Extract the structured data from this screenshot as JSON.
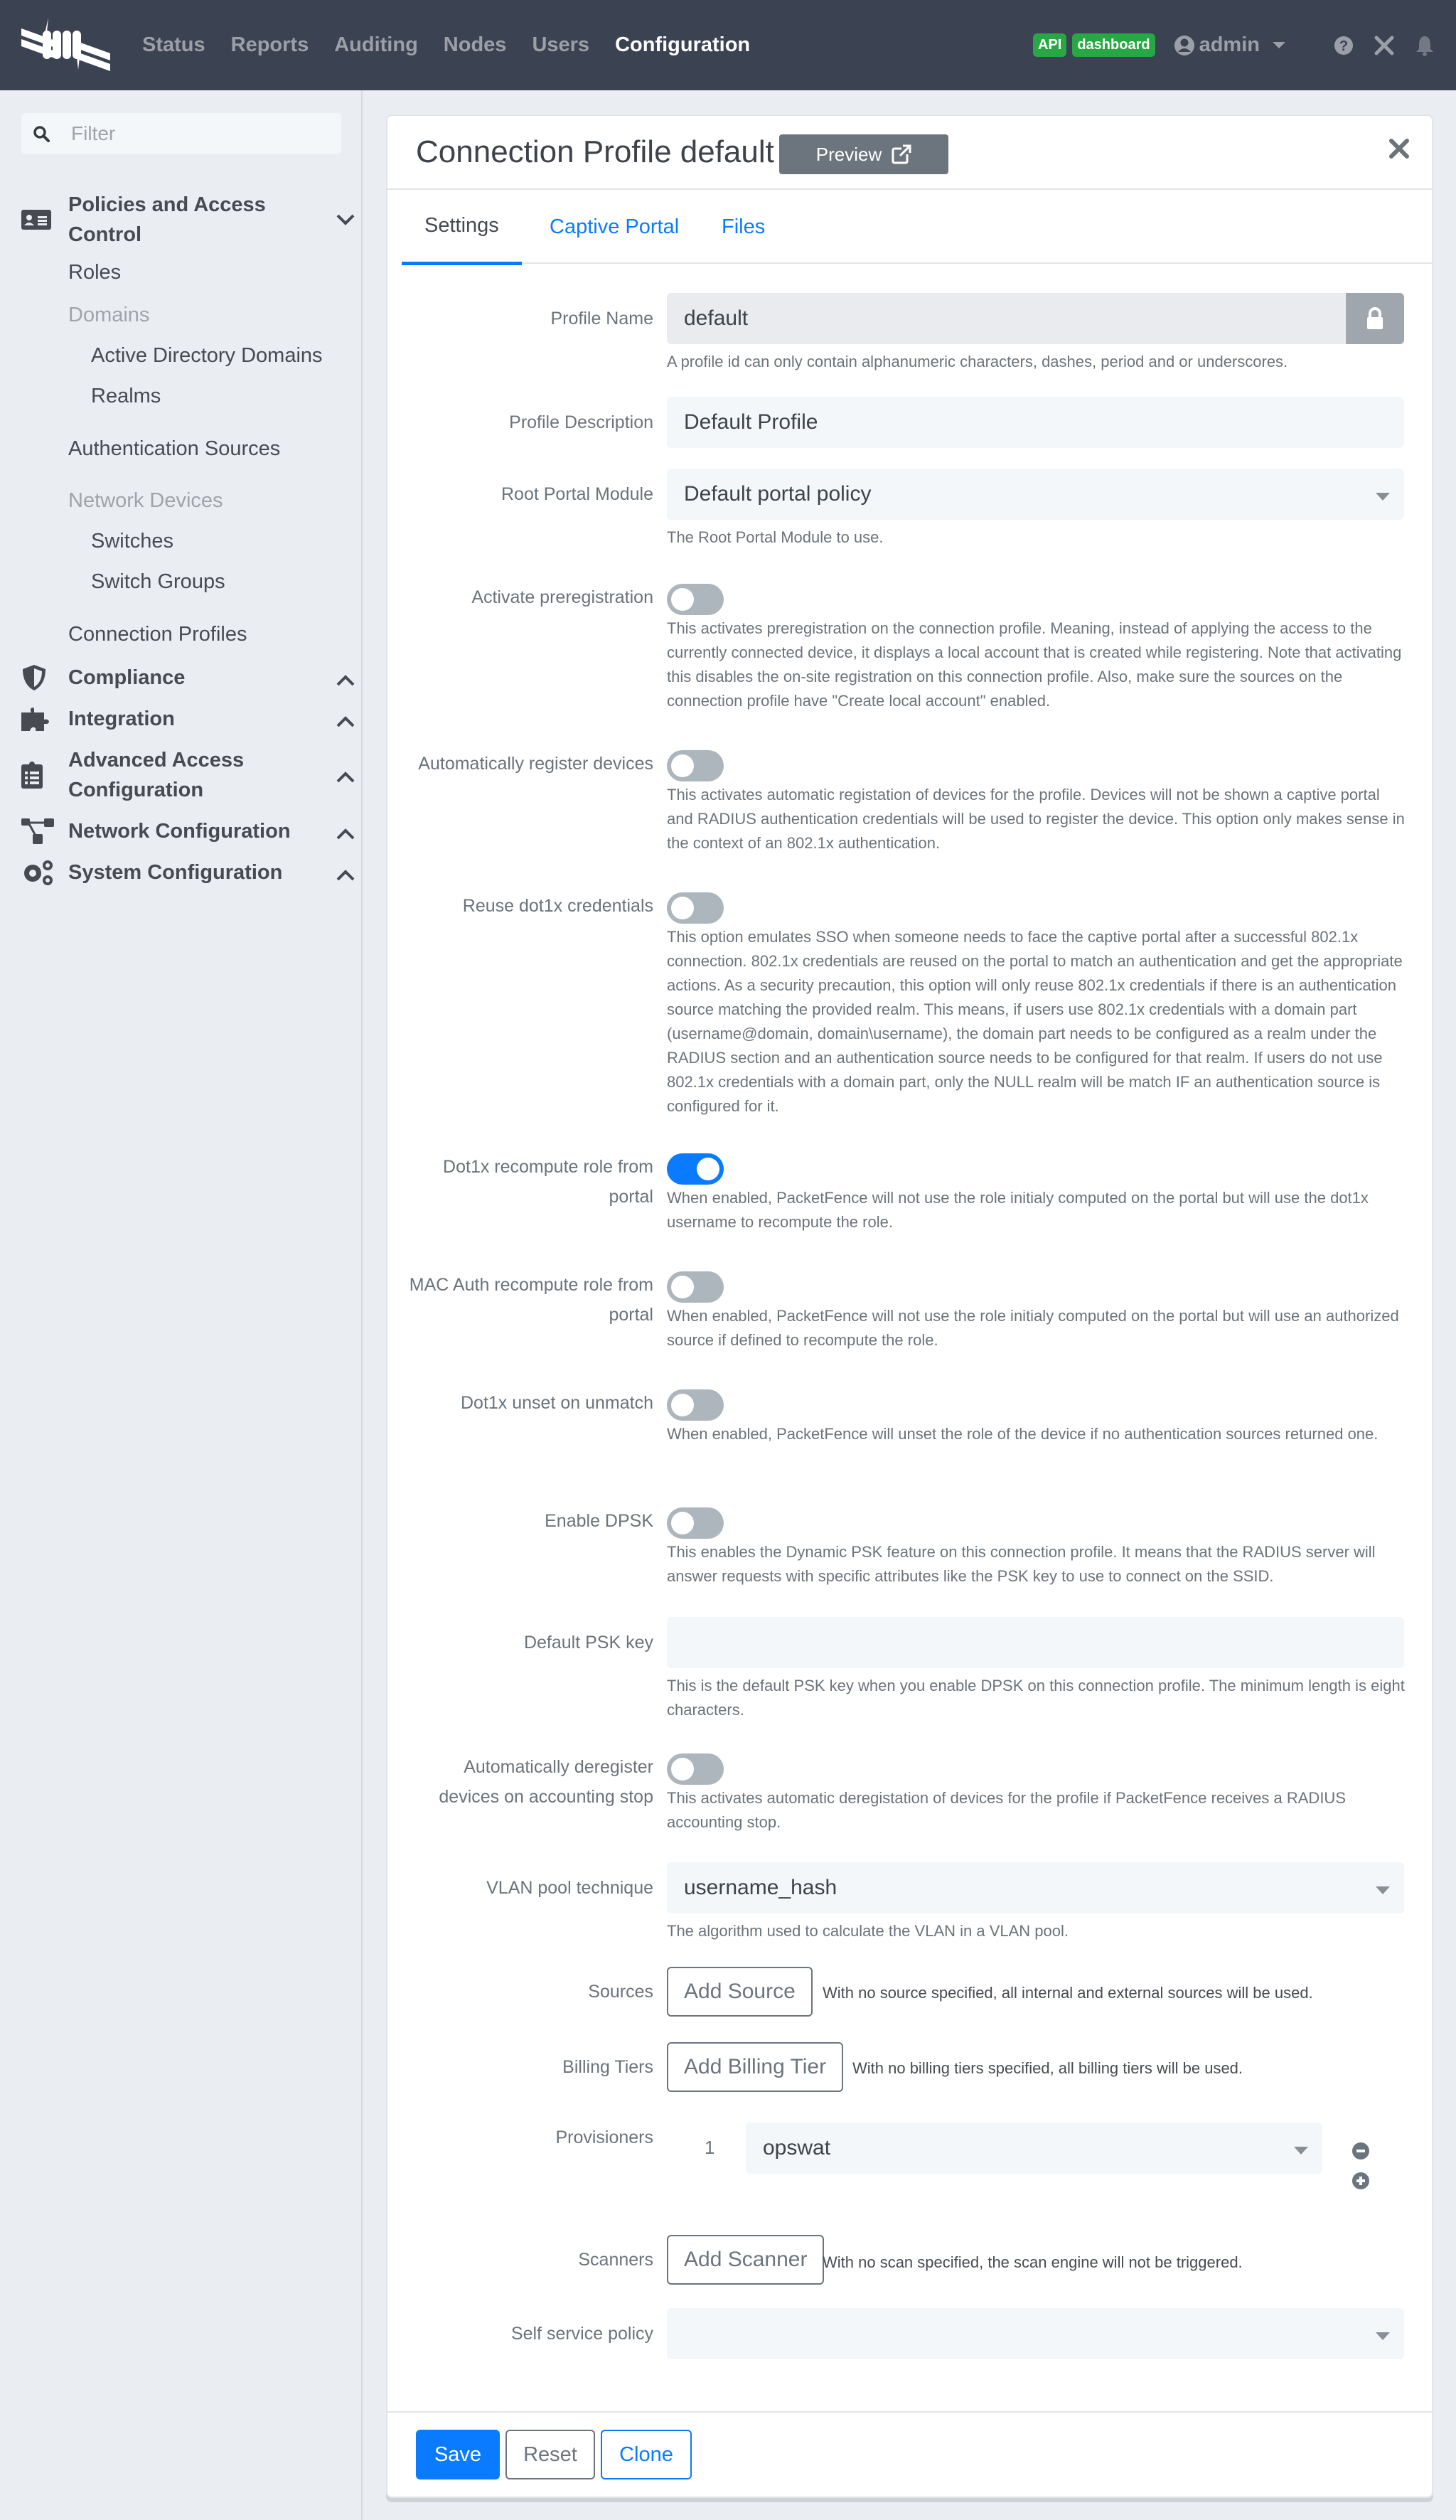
{
  "topnav": {
    "links": [
      "Status",
      "Reports",
      "Auditing",
      "Nodes",
      "Users",
      "Configuration"
    ],
    "active": "Configuration",
    "badges": [
      "API",
      "dashboard"
    ],
    "user": "admin"
  },
  "sidebar": {
    "filter_placeholder": "Filter",
    "groups": [
      {
        "label": "Policies and Access Control",
        "expanded": true
      },
      {
        "label": "Compliance",
        "expanded": false
      },
      {
        "label": "Integration",
        "expanded": false
      },
      {
        "label": "Advanced Access Configuration",
        "expanded": false
      },
      {
        "label": "Network Configuration",
        "expanded": false
      },
      {
        "label": "System Configuration",
        "expanded": false
      }
    ],
    "items": {
      "roles": "Roles",
      "domains": "Domains",
      "ad_domains": "Active Directory Domains",
      "realms": "Realms",
      "auth_sources": "Authentication Sources",
      "network_devices": "Network Devices",
      "switches": "Switches",
      "switch_groups": "Switch Groups",
      "connection_profiles": "Connection Profiles"
    }
  },
  "card": {
    "title": "Connection Profile default",
    "preview_label": "Preview",
    "tabs": [
      "Settings",
      "Captive Portal",
      "Files"
    ],
    "active_tab": "Settings"
  },
  "form": {
    "profile_name": {
      "label": "Profile Name",
      "value": "default",
      "help": "A profile id can only contain alphanumeric characters, dashes, period and or underscores."
    },
    "profile_description": {
      "label": "Profile Description",
      "value": "Default Profile"
    },
    "root_portal_module": {
      "label": "Root Portal Module",
      "value": "Default portal policy",
      "help": "The Root Portal Module to use."
    },
    "activate_preregistration": {
      "label": "Activate preregistration",
      "enabled": false,
      "help": "This activates preregistration on the connection profile. Meaning, instead of applying the access to the currently connected device, it displays a local account that is created while registering. Note that activating this disables the on-site registration on this connection profile. Also, make sure the sources on the connection profile have \"Create local account\" enabled."
    },
    "auto_register": {
      "label": "Automatically register devices",
      "enabled": false,
      "help": "This activates automatic registation of devices for the profile. Devices will not be shown a captive portal and RADIUS authentication credentials will be used to register the device. This option only makes sense in the context of an 802.1x authentication."
    },
    "reuse_dot1x": {
      "label": "Reuse dot1x credentials",
      "enabled": false,
      "help": "This option emulates SSO when someone needs to face the captive portal after a successful 802.1x connection. 802.1x credentials are reused on the portal to match an authentication and get the appropriate actions. As a security precaution, this option will only reuse 802.1x credentials if there is an authentication source matching the provided realm. This means, if users use 802.1x credentials with a domain part (username@domain, domain\\username), the domain part needs to be configured as a realm under the RADIUS section and an authentication source needs to be configured for that realm. If users do not use 802.1x credentials with a domain part, only the NULL realm will be match IF an authentication source is configured for it."
    },
    "dot1x_recompute": {
      "label": "Dot1x recompute role from portal",
      "enabled": true,
      "help": "When enabled, PacketFence will not use the role initialy computed on the portal but will use the dot1x username to recompute the role."
    },
    "mac_auth_recompute": {
      "label": "MAC Auth recompute role from portal",
      "enabled": false,
      "help": "When enabled, PacketFence will not use the role initialy computed on the portal but will use an authorized source if defined to recompute the role."
    },
    "dot1x_unset": {
      "label": "Dot1x unset on unmatch",
      "enabled": false,
      "help": "When enabled, PacketFence will unset the role of the device if no authentication sources returned one."
    },
    "enable_dpsk": {
      "label": "Enable DPSK",
      "enabled": false,
      "help": "This enables the Dynamic PSK feature on this connection profile. It means that the RADIUS server will answer requests with specific attributes like the PSK key to use to connect on the SSID."
    },
    "default_psk": {
      "label": "Default PSK key",
      "value": "",
      "help": "This is the default PSK key when you enable DPSK on this connection profile. The minimum length is eight characters."
    },
    "auto_deregister": {
      "label": "Automatically deregister devices on accounting stop",
      "enabled": false,
      "help": "This activates automatic deregistation of devices for the profile if PacketFence receives a RADIUS accounting stop."
    },
    "vlan_pool": {
      "label": "VLAN pool technique",
      "value": "username_hash",
      "help": "The algorithm used to calculate the VLAN in a VLAN pool."
    },
    "sources": {
      "label": "Sources",
      "button": "Add Source",
      "help": "With no source specified, all internal and external sources will be used."
    },
    "billing_tiers": {
      "label": "Billing Tiers",
      "button": "Add Billing Tier",
      "help": "With no billing tiers specified, all billing tiers will be used."
    },
    "provisioners": {
      "label": "Provisioners",
      "items": [
        {
          "index": "1",
          "value": "opswat"
        }
      ]
    },
    "scanners": {
      "label": "Scanners",
      "button": "Add Scanner",
      "help": "With no scan specified, the scan engine will not be triggered."
    },
    "self_service": {
      "label": "Self service policy",
      "value": ""
    }
  },
  "footer": {
    "save": "Save",
    "reset": "Reset",
    "clone": "Clone"
  },
  "colors": {
    "primary": "#0a7bff",
    "nav_bg": "#3b4252",
    "badge": "#28a745",
    "secondary": "#6c757d"
  }
}
